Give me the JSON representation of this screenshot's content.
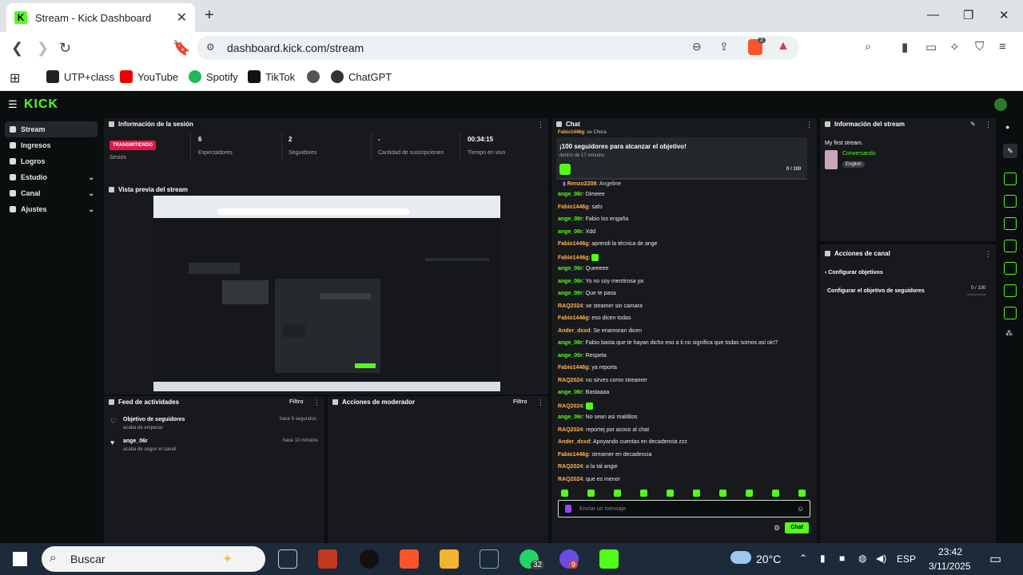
{
  "browser": {
    "tab_title": "Stream - Kick Dashboard",
    "url": "dashboard.kick.com/stream",
    "extension_count": "2",
    "bookmarks": [
      "UTP+class",
      "YouTube",
      "Spotify",
      "TikTok",
      "ChatGPT"
    ]
  },
  "app": {
    "logo": "KICK",
    "sidebar": [
      {
        "label": "Stream",
        "active": true,
        "chevron": false
      },
      {
        "label": "Ingresos",
        "active": false,
        "chevron": false
      },
      {
        "label": "Logros",
        "active": false,
        "chevron": false
      },
      {
        "label": "Estudio",
        "active": false,
        "chevron": true
      },
      {
        "label": "Canal",
        "active": false,
        "chevron": true
      },
      {
        "label": "Ajustes",
        "active": false,
        "chevron": true
      }
    ]
  },
  "session": {
    "title": "Información de la sesión",
    "status": "TRANSMITIENDO",
    "status_label": "Sesión",
    "stats": [
      {
        "value": "6",
        "label": "Espectadores"
      },
      {
        "value": "2",
        "label": "Seguidores"
      },
      {
        "value": "-",
        "label": "Cantidad de suscripciones"
      },
      {
        "value": "00:34:15",
        "label": "Tiempo en vivo"
      }
    ]
  },
  "preview": {
    "title": "Vista previa del stream"
  },
  "activity": {
    "title": "Feed de actividades",
    "filter": "Filtro",
    "items": [
      {
        "title": "Objetivo de seguidores",
        "sub": "acaba de empezar",
        "time": "hace 9 segundos"
      },
      {
        "title": "ange_06r",
        "sub": "acaba de seguir el canal!",
        "time": "hace 10 minutos"
      }
    ]
  },
  "moderator": {
    "title": "Acciones de moderador",
    "filter": "Filtro"
  },
  "chat": {
    "title": "Chat",
    "top_line": {
      "user": "Fabio1446g",
      "text": "se Chora"
    },
    "goal": {
      "title": "¡100 seguidores para alcanzar el objetivo!",
      "sub": "dentro de 17 minutos",
      "progress": "0 / 100"
    },
    "partial": {
      "user": "Renzo2208",
      "text": "Angeline"
    },
    "messages": [
      {
        "user": "ange_06r",
        "text": "Dimeee",
        "color": "#53fc18"
      },
      {
        "user": "Fabio1446g",
        "text": "safo",
        "color": "#ffb34d"
      },
      {
        "user": "ange_06r",
        "text": "Fabio los engaña",
        "color": "#53fc18"
      },
      {
        "user": "ange_06r",
        "text": "Xdd",
        "color": "#53fc18"
      },
      {
        "user": "Fabio1446g",
        "text": "aprendi la técnica de ange",
        "color": "#ffb34d"
      },
      {
        "user": "Fabio1446g",
        "text": "",
        "color": "#ffb34d"
      },
      {
        "user": "ange_06r",
        "text": "Queeeee",
        "color": "#53fc18"
      },
      {
        "user": "ange_06r",
        "text": "Yo no soy mentirosa ya",
        "color": "#53fc18"
      },
      {
        "user": "ange_06r",
        "text": "Que te pasa",
        "color": "#53fc18"
      },
      {
        "user": "RAQ2024",
        "text": "se steamer sin camara",
        "color": "#ffb34d"
      },
      {
        "user": "Fabio1446g",
        "text": "eso dicen todas",
        "color": "#ffb34d"
      },
      {
        "user": "Ander_dxxd",
        "text": "Se enamoran dicen",
        "color": "#ffb34d"
      },
      {
        "user": "ange_06r",
        "text": "Fabio basta que te hayan dicho eso a ti no significa que todas somos asi ok!?",
        "color": "#53fc18"
      },
      {
        "user": "ange_06r",
        "text": "Respeta",
        "color": "#53fc18"
      },
      {
        "user": "Fabio1446g",
        "text": "ya reporta",
        "color": "#ffb34d"
      },
      {
        "user": "RAQ2024",
        "text": "no sirves como streamer",
        "color": "#ffb34d"
      },
      {
        "user": "ange_06r",
        "text": "Bastaaaa",
        "color": "#53fc18"
      },
      {
        "user": "RAQ2024",
        "text": "",
        "color": "#ffb34d"
      },
      {
        "user": "ange_06r",
        "text": "No sean asi malditos",
        "color": "#53fc18"
      },
      {
        "user": "RAQ2024",
        "text": "reportej por acoso al chat",
        "color": "#ffb34d"
      },
      {
        "user": "Ander_dxxd",
        "text": "Apoyando cuentas en decadencia zzz",
        "color": "#ffb34d"
      },
      {
        "user": "Fabio1446g",
        "text": "streamer en decadencia",
        "color": "#ffb34d"
      },
      {
        "user": "RAQ2024",
        "text": "a la tal angie",
        "color": "#ffb34d"
      },
      {
        "user": "RAQ2024",
        "text": "que es menor",
        "color": "#ffb34d"
      }
    ],
    "input_placeholder": "Enviar un mensaje",
    "send_label": "Chat"
  },
  "stream_info": {
    "title": "Información del stream",
    "stream_title": "My first stream.",
    "category": "Conversando",
    "language": "English"
  },
  "channel_actions": {
    "title": "Acciones de canal",
    "back": "Configurar objetivos",
    "goal_label": "Configurar el objetivo de seguidores",
    "goal_value": "0 / 100"
  },
  "taskbar": {
    "search": "Buscar",
    "whatsapp_badge": "32",
    "app_badge": "9",
    "temperature": "20°C",
    "lang": "ESP",
    "time": "23:42",
    "date": "3/11/2025"
  }
}
